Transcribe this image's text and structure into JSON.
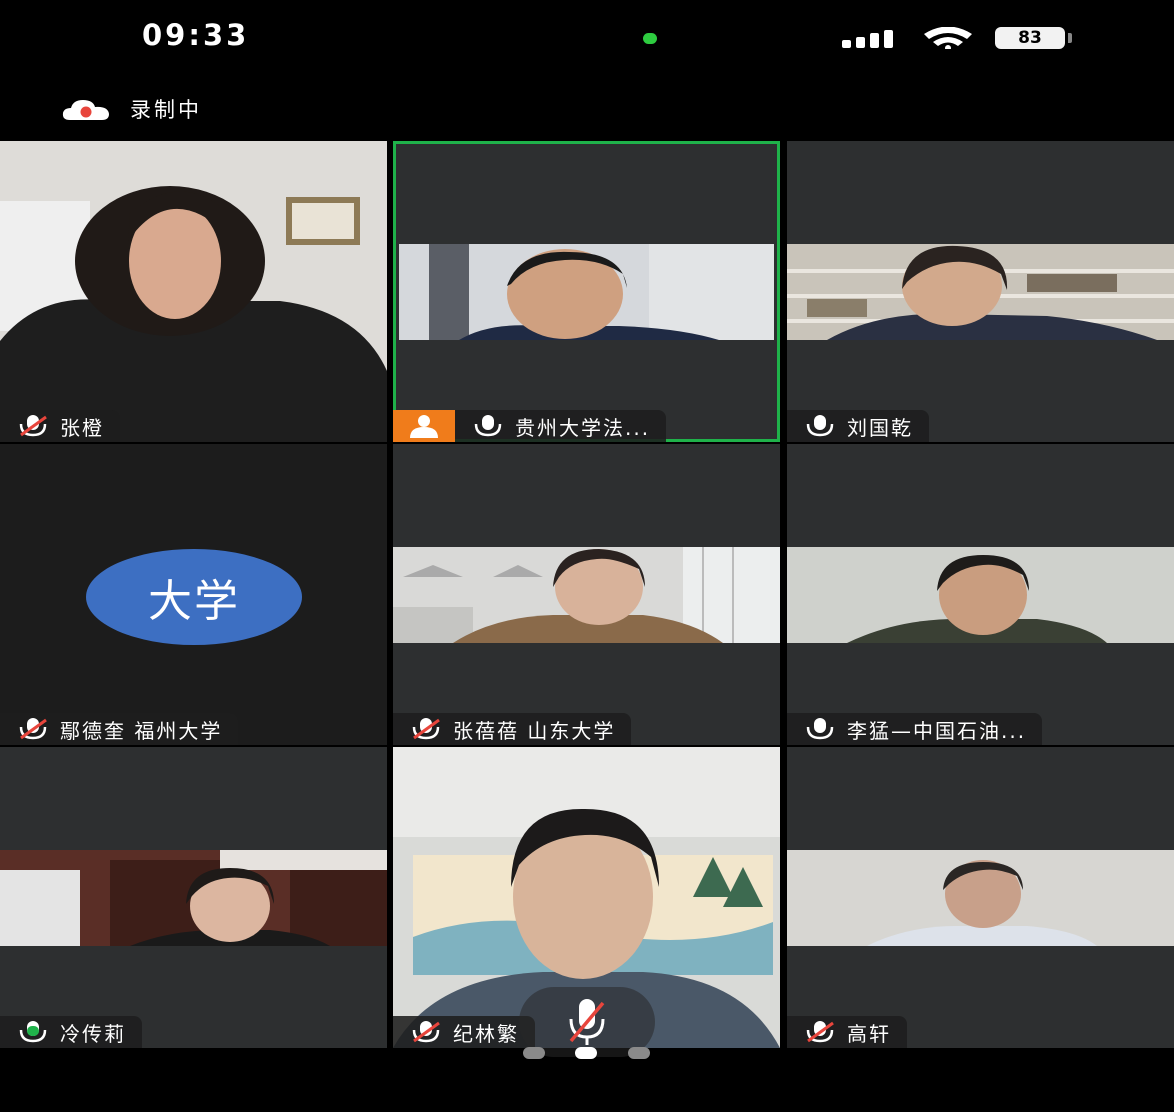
{
  "status_bar": {
    "time": "09:33",
    "battery": "83"
  },
  "recording": {
    "label": "录制中"
  },
  "colors": {
    "speaking_border": "#1fb24a",
    "host_badge": "#f07c1b",
    "avatar_bg": "#3d6fc2",
    "tile_bg": "#2d2f30"
  },
  "participants": [
    {
      "name": "张橙",
      "muted": true
    },
    {
      "name": "贵州大学法...",
      "muted": false,
      "host": true,
      "speaking": true
    },
    {
      "name": "刘国乾",
      "muted": false
    },
    {
      "name": "鄢德奎 福州大学",
      "muted": true,
      "avatar_text": "大学"
    },
    {
      "name": "张蓓蓓 山东大学",
      "muted": true
    },
    {
      "name": "李猛—中国石油...",
      "muted": false
    },
    {
      "name": "冷传莉",
      "muted": false,
      "mic_active": true
    },
    {
      "name": "纪林繁",
      "muted": true
    },
    {
      "name": "高轩",
      "muted": true
    }
  ],
  "pagination": {
    "pages": 3,
    "current": 2
  }
}
